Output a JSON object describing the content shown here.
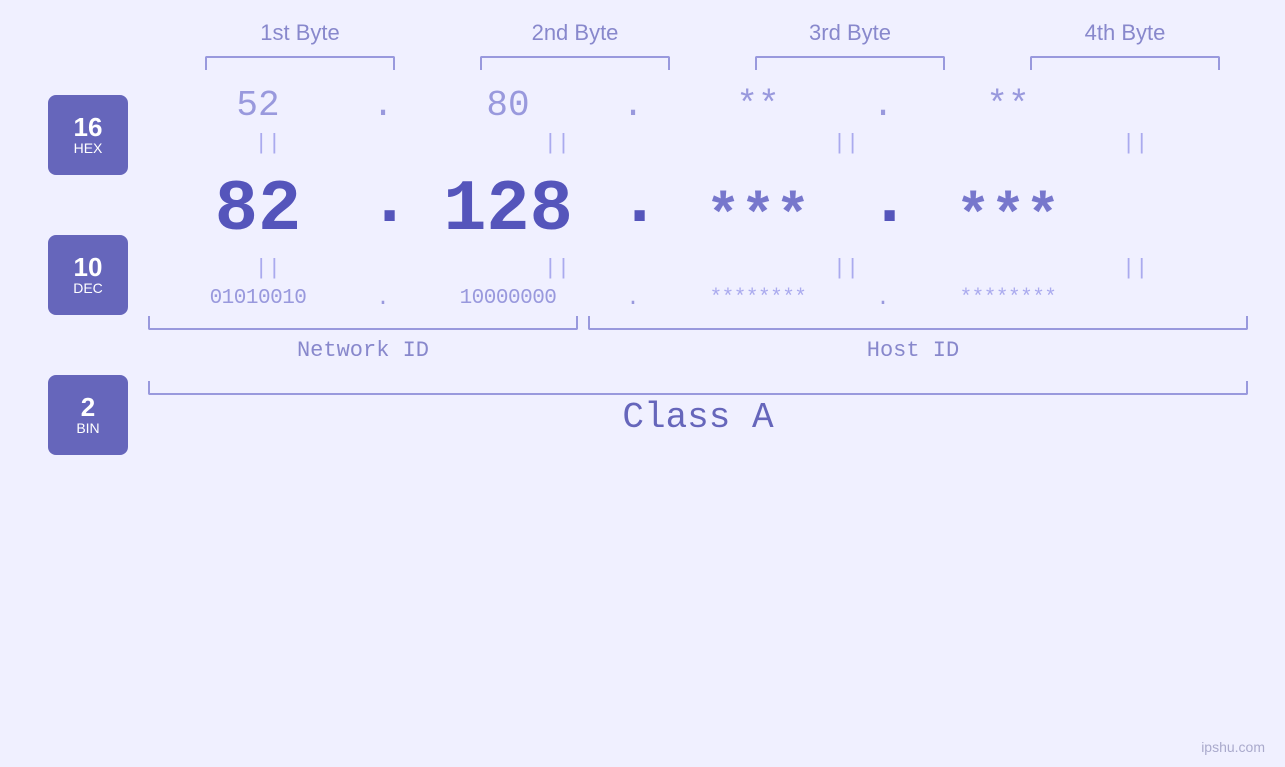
{
  "headers": {
    "byte1": "1st Byte",
    "byte2": "2nd Byte",
    "byte3": "3rd Byte",
    "byte4": "4th Byte"
  },
  "badges": {
    "hex": {
      "num": "16",
      "label": "HEX"
    },
    "dec": {
      "num": "10",
      "label": "DEC"
    },
    "bin": {
      "num": "2",
      "label": "BIN"
    }
  },
  "hex_values": {
    "b1": "52",
    "b2": "80",
    "b3": "**",
    "b4": "**"
  },
  "dec_values": {
    "b1": "82",
    "b2": "128",
    "b3": "***",
    "b4": "***"
  },
  "bin_values": {
    "b1": "01010010",
    "b2": "10000000",
    "b3": "********",
    "b4": "********"
  },
  "labels": {
    "network_id": "Network ID",
    "host_id": "Host ID",
    "class": "Class A"
  },
  "watermark": "ipshu.com",
  "dots": ".",
  "eq": "||"
}
